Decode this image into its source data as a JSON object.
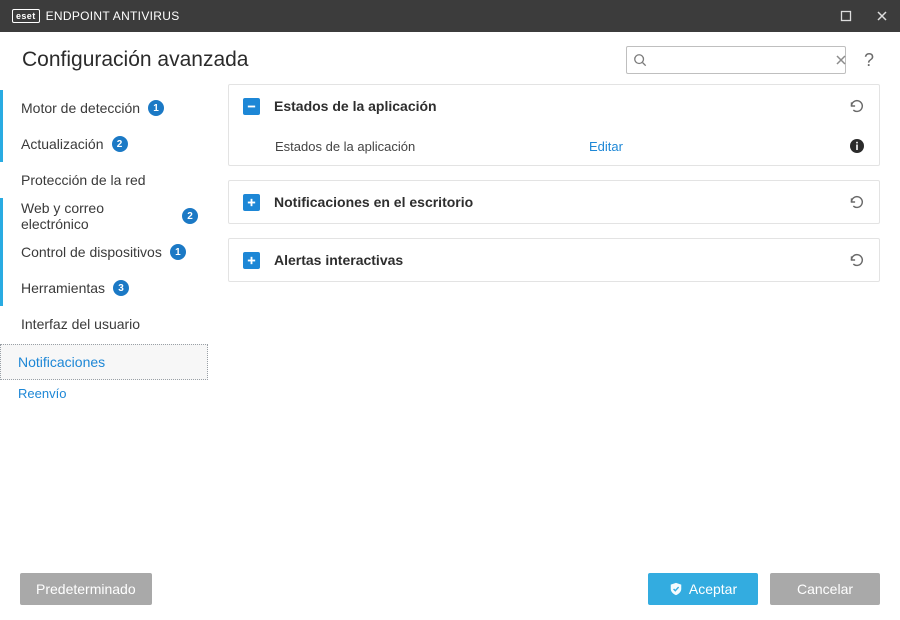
{
  "titlebar": {
    "brand_box": "eset",
    "brand_name": "ENDPOINT ANTIVIRUS"
  },
  "header": {
    "title": "Configuración avanzada",
    "search_placeholder": "",
    "help": "?"
  },
  "sidebar": {
    "items": [
      {
        "label": "Motor de detección",
        "badge": "1"
      },
      {
        "label": "Actualización",
        "badge": "2"
      },
      {
        "label": "Protección de la red",
        "badge": ""
      },
      {
        "label": "Web y correo electrónico",
        "badge": "2"
      },
      {
        "label": "Control de dispositivos",
        "badge": "1"
      },
      {
        "label": "Herramientas",
        "badge": "3"
      },
      {
        "label": "Interfaz del usuario",
        "badge": ""
      }
    ],
    "selected": {
      "label": "Notificaciones"
    },
    "sub": {
      "label": "Reenvío"
    }
  },
  "panels": {
    "p0": {
      "title": "Estados de la aplicación",
      "row_label": "Estados de la aplicación",
      "row_action": "Editar"
    },
    "p1": {
      "title": "Notificaciones en el escritorio"
    },
    "p2": {
      "title": "Alertas interactivas"
    }
  },
  "footer": {
    "default": "Predeterminado",
    "accept": "Aceptar",
    "cancel": "Cancelar"
  }
}
